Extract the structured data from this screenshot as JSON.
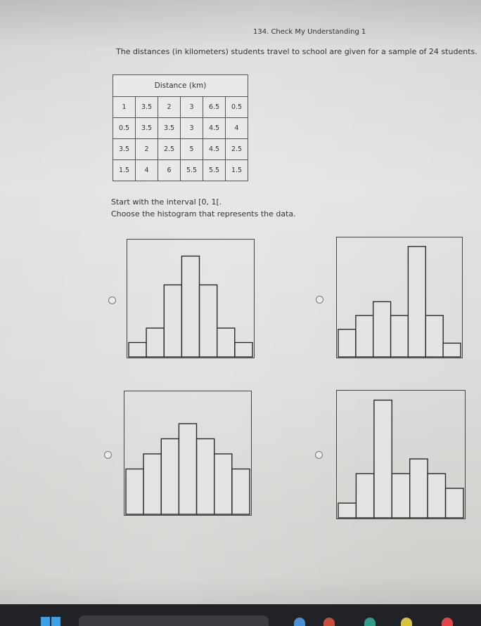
{
  "title": "134. Check My Understanding 1",
  "question": "The distances (in kilometers) students travel to school are given for a sample of 24 students.",
  "table": {
    "header": "Distance (km)",
    "rows": [
      [
        "1",
        "3.5",
        "2",
        "3",
        "6.5",
        "0.5"
      ],
      [
        "0.5",
        "3.5",
        "3.5",
        "3",
        "4.5",
        "4"
      ],
      [
        "3.5",
        "2",
        "2.5",
        "5",
        "4.5",
        "2.5"
      ],
      [
        "1.5",
        "4",
        "6",
        "5.5",
        "5.5",
        "1.5"
      ]
    ]
  },
  "instruction_1": "Start with the interval [0, 1[.",
  "instruction_2": "Choose the histogram that represents the data.",
  "chart_data": [
    {
      "type": "bar",
      "option": "A",
      "values": [
        1,
        2,
        5,
        7,
        5,
        2,
        1
      ],
      "ylim": [
        0,
        8
      ]
    },
    {
      "type": "bar",
      "option": "B",
      "values": [
        2,
        3,
        4,
        3,
        8,
        3,
        1
      ],
      "ylim": [
        0,
        8.5
      ]
    },
    {
      "type": "bar",
      "option": "C",
      "values": [
        3,
        4,
        5,
        6,
        5,
        4,
        3
      ],
      "ylim": [
        0,
        8
      ]
    },
    {
      "type": "bar",
      "option": "D",
      "values": [
        1,
        3,
        8,
        3,
        4,
        3,
        2
      ],
      "ylim": [
        0,
        8.5
      ]
    }
  ],
  "colors": {
    "bar_fill": "#e4e4e2",
    "bar_stroke": "#2a2a2a",
    "taskbar": "#202225",
    "start_blue": "#3aa0e8"
  },
  "icons": [
    "radio-unselected-icon",
    "windows-start-icon",
    "search-box",
    "taskbar-app-icon"
  ]
}
